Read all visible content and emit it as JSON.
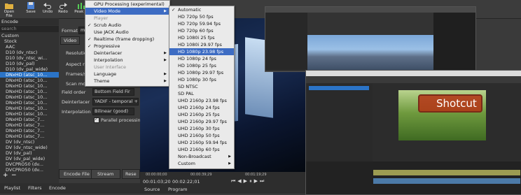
{
  "toolbar": {
    "buttons": [
      {
        "label": "Open File",
        "icon": "folder-open-icon"
      },
      {
        "label": "Save",
        "icon": "save-icon"
      },
      {
        "label": "Undo",
        "icon": "undo-icon"
      },
      {
        "label": "Redo",
        "icon": "redo-icon"
      },
      {
        "label": "Peak M",
        "icon": "peak-meter-icon"
      }
    ]
  },
  "encode_panel": {
    "header": "Encode",
    "search_placeholder": "search",
    "presets": [
      {
        "label": "Custom",
        "level": "top",
        "selected": false
      },
      {
        "label": "Stock",
        "level": "top-expanded",
        "selected": false
      },
      {
        "label": "AAC",
        "level": "child",
        "selected": false
      },
      {
        "label": "D10 (dv_ntsc)",
        "level": "child",
        "selected": false
      },
      {
        "label": "D10 (dv_ntsc_wi...",
        "level": "child",
        "selected": false
      },
      {
        "label": "D10 (dv_pal)",
        "level": "child",
        "selected": false
      },
      {
        "label": "D10 (dv_pal_wide)",
        "level": "child",
        "selected": false
      },
      {
        "label": "DNxHD (atsc_10...",
        "level": "child",
        "selected": true
      },
      {
        "label": "DNxHD (atsc_10...",
        "level": "child",
        "selected": false
      },
      {
        "label": "DNxHD (atsc_10...",
        "level": "child",
        "selected": false
      },
      {
        "label": "DNxHD (atsc_10...",
        "level": "child",
        "selected": false
      },
      {
        "label": "DNxHD (atsc_10...",
        "level": "child",
        "selected": false
      },
      {
        "label": "DNxHD (atsc_10...",
        "level": "child",
        "selected": false
      },
      {
        "label": "DNxHD (atsc_10...",
        "level": "child",
        "selected": false
      },
      {
        "label": "DNxHD (atsc_10...",
        "level": "child",
        "selected": false
      },
      {
        "label": "DNxHD (atsc_7...",
        "level": "child",
        "selected": false
      },
      {
        "label": "DNxHD (atsc_7...",
        "level": "child",
        "selected": false
      },
      {
        "label": "DNxHD (atsc_7...",
        "level": "child",
        "selected": false
      },
      {
        "label": "DNxHD (atsc_7...",
        "level": "child",
        "selected": false
      },
      {
        "label": "DV (dv_ntsc)",
        "level": "child",
        "selected": false
      },
      {
        "label": "DV (dv_ntsc_wide)",
        "level": "child",
        "selected": false
      },
      {
        "label": "DV (dv_pal)",
        "level": "child",
        "selected": false
      },
      {
        "label": "DV (dv_pal_wide)",
        "level": "child",
        "selected": false
      },
      {
        "label": "DVCPRO50 (dv...",
        "level": "child",
        "selected": false
      },
      {
        "label": "DVCPRO50 (dv...",
        "level": "child",
        "selected": false
      }
    ],
    "add_symbol": "+",
    "remove_symbol": "−"
  },
  "form": {
    "format_label": "Format",
    "format_value": "mov",
    "video_tab": "Video",
    "resolution_label": "Resolution",
    "aspect_ratio_label": "Aspect ra",
    "frames_label": "Frames/s",
    "scan_mode_label": "Scan mo",
    "field_order_label": "Field order",
    "field_order_value": "Bottom Field Fir",
    "deinterlacer_label": "Deinterlacer",
    "deinterlacer_value": "YADIF - temporal +",
    "interpolation_label": "Interpolation",
    "interpolation_value": "Bilinear (good)",
    "parallel_label": "Parallel processing",
    "encode_file_button": "Encode File",
    "stream_button": "Stream",
    "reset_button": "Rese"
  },
  "bottom_tabs": [
    "Playlist",
    "Filters",
    "Encode"
  ],
  "settings_menu": {
    "items": [
      {
        "label": "GPU Processing (experimental)",
        "checked": false,
        "dim": false,
        "submenu": false,
        "selected": false
      },
      {
        "label": "Video Mode",
        "checked": false,
        "dim": false,
        "submenu": true,
        "selected": true
      },
      {
        "label": "Player",
        "checked": false,
        "dim": true,
        "submenu": false,
        "selected": false
      },
      {
        "label": "Scrub Audio",
        "checked": true,
        "dim": false,
        "submenu": false,
        "selected": false
      },
      {
        "label": "Use JACK Audio",
        "checked": false,
        "dim": false,
        "submenu": false,
        "selected": false
      },
      {
        "label": "Realtime (frame dropping)",
        "checked": true,
        "dim": false,
        "submenu": false,
        "selected": false
      },
      {
        "label": "Progressive",
        "checked": true,
        "dim": false,
        "submenu": false,
        "selected": false
      },
      {
        "label": "Deinterlacer",
        "checked": false,
        "dim": false,
        "submenu": true,
        "selected": false
      },
      {
        "label": "Interpolation",
        "checked": false,
        "dim": false,
        "submenu": true,
        "selected": false
      },
      {
        "label": "User Interface",
        "checked": false,
        "dim": true,
        "submenu": false,
        "selected": false
      },
      {
        "label": "Language",
        "checked": false,
        "dim": false,
        "submenu": true,
        "selected": false
      },
      {
        "label": "Theme",
        "checked": false,
        "dim": false,
        "submenu": true,
        "selected": false
      }
    ]
  },
  "video_mode_menu": {
    "items": [
      {
        "label": "Automatic",
        "checked": true,
        "submenu": false,
        "selected": false
      },
      {
        "label": "HD 720p 50 fps",
        "checked": false,
        "submenu": false,
        "selected": false
      },
      {
        "label": "HD 720p 59.94 fps",
        "checked": false,
        "submenu": false,
        "selected": false
      },
      {
        "label": "HD 720p 60 fps",
        "checked": false,
        "submenu": false,
        "selected": false
      },
      {
        "label": "HD 1080i 25 fps",
        "checked": false,
        "submenu": false,
        "selected": false
      },
      {
        "label": "HD 1080i 29.97 fps",
        "checked": false,
        "submenu": false,
        "selected": false
      },
      {
        "label": "HD 1080p 23.98 fps",
        "checked": false,
        "submenu": false,
        "selected": true
      },
      {
        "label": "HD 1080p 24 fps",
        "checked": false,
        "submenu": false,
        "selected": false
      },
      {
        "label": "HD 1080p 25 fps",
        "checked": false,
        "submenu": false,
        "selected": false
      },
      {
        "label": "HD 1080p 29.97 fps",
        "checked": false,
        "submenu": false,
        "selected": false
      },
      {
        "label": "HD 1080p 30 fps",
        "checked": false,
        "submenu": false,
        "selected": false
      },
      {
        "label": "SD NTSC",
        "checked": false,
        "submenu": false,
        "selected": false
      },
      {
        "label": "SD PAL",
        "checked": false,
        "submenu": false,
        "selected": false
      },
      {
        "label": "UHD 2160p 23.98 fps",
        "checked": false,
        "submenu": false,
        "selected": false
      },
      {
        "label": "UHD 2160p 24 fps",
        "checked": false,
        "submenu": false,
        "selected": false
      },
      {
        "label": "UHD 2160p 25 fps",
        "checked": false,
        "submenu": false,
        "selected": false
      },
      {
        "label": "UHD 2160p 29.97 fps",
        "checked": false,
        "submenu": false,
        "selected": false
      },
      {
        "label": "UHD 2160p 30 fps",
        "checked": false,
        "submenu": false,
        "selected": false
      },
      {
        "label": "UHD 2160p 50 fps",
        "checked": false,
        "submenu": false,
        "selected": false
      },
      {
        "label": "UHD 2160p 59.94 fps",
        "checked": false,
        "submenu": false,
        "selected": false
      },
      {
        "label": "UHD 2160p 60 fps",
        "checked": false,
        "submenu": false,
        "selected": false
      },
      {
        "label": "Non-Broadcast",
        "checked": false,
        "submenu": true,
        "selected": false
      },
      {
        "label": "Custom",
        "checked": false,
        "submenu": true,
        "selected": false
      }
    ]
  },
  "player": {
    "timecode_current": "00:01:03;20",
    "timecode_total": "00:02:22;01",
    "ruler_start": "00:00:00;00",
    "ruler_mid": "00:00:39;29",
    "ruler_end": "00:01:19;29",
    "tabs": [
      "Source",
      "Program"
    ]
  },
  "overlay_logo": {
    "text": "Shotcut"
  },
  "colors": {
    "accent": "#2b74c7",
    "menu_selected": "#3d6cc3",
    "menu_bg": "#eaeaea"
  }
}
